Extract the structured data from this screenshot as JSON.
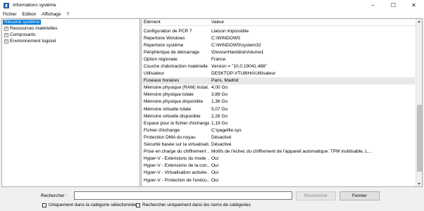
{
  "window": {
    "title": "Informations système",
    "controls": [
      "–",
      "☐",
      "✕"
    ]
  },
  "menu": [
    "Fichier",
    "Edition",
    "Affichage",
    "?"
  ],
  "tree": {
    "root": "Résumé système",
    "children": [
      "Ressources matérielles",
      "Composants",
      "Environnement logiciel"
    ],
    "expander": "+"
  },
  "list": {
    "headers": {
      "element": "Élément",
      "value": "Valeur"
    },
    "rows": [
      {
        "element": "Configuration de PCR 7",
        "value": "Liaison impossible"
      },
      {
        "element": "Répertoire Windows",
        "value": "C:\\WINDOWS"
      },
      {
        "element": "Répertoire système",
        "value": "C:\\WINDOWS\\system32"
      },
      {
        "element": "Périphérique de démarrage",
        "value": "\\Device\\HarddiskVolume1"
      },
      {
        "element": "Option régionale",
        "value": "France"
      },
      {
        "element": "Couche d'abstraction matérielle",
        "value": "Version = \"10.0.19041.488\""
      },
      {
        "element": "Utilisateur",
        "value": "DESKTOP-VTU8IHA\\Utilisateur"
      },
      {
        "element": "Fuseaux horaires",
        "value": "Paris, Madrid"
      },
      {
        "element": "Mémoire physique (RAM) instal...",
        "value": "4,00 Go"
      },
      {
        "element": "Mémoire physique totale",
        "value": "3,89 Go"
      },
      {
        "element": "Mémoire physique disponible",
        "value": "1,36 Go"
      },
      {
        "element": "Mémoire virtuelle totale",
        "value": "5,07 Go"
      },
      {
        "element": "Mémoire virtuelle disponible",
        "value": "2,26 Go"
      },
      {
        "element": "Espace pour le fichier d'échange",
        "value": "1,19 Go"
      },
      {
        "element": "Fichier d'échange",
        "value": "C:\\pagefile.sys"
      },
      {
        "element": "Protection DMA du noyau",
        "value": "Désactivé"
      },
      {
        "element": "Sécurité basée sur la virtualisati...",
        "value": "Désactivé"
      },
      {
        "element": "Prise en charge du chiffrement ...",
        "value": "Motifs de l'échec du chiffrement de l'appareil automatique: TPM inutilisable, L..."
      },
      {
        "element": "Hyper-V - Extensions du mode ...",
        "value": "Oui"
      },
      {
        "element": "Hyper-V - Extensions de la con...",
        "value": "Oui"
      },
      {
        "element": "Hyper-V - Virtualisation activée...",
        "value": "Oui"
      },
      {
        "element": "Hyper-V - Protection de l'exécu...",
        "value": "Oui"
      }
    ],
    "highlighted_row": "Fuseaux horaires"
  },
  "bottom": {
    "search_label": "Rechercher :",
    "search_value": "",
    "search_button": "Rechercher",
    "close_button": "Fermer",
    "check1_label": "Uniquement dans la catégorie sélectionnée",
    "check2_label": "Rechercher uniquement dans les noms de catégories"
  },
  "colors": {
    "selection": "#0078d7",
    "row_highlight": "#e8e8e8"
  }
}
